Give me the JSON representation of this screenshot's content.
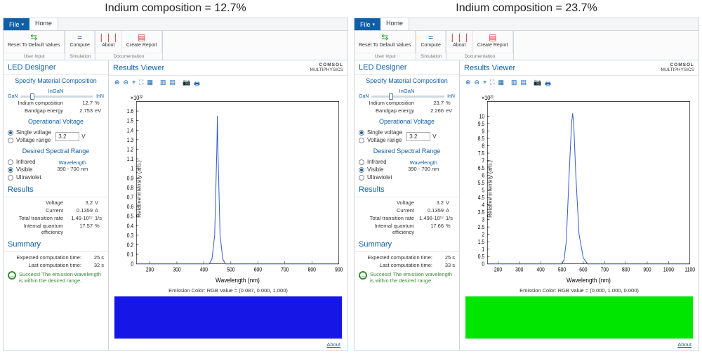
{
  "panels": [
    {
      "title_text": "Indium composition = 12.7%",
      "ribbon": {
        "file": "File",
        "home": "Home",
        "reset": "Reset To\nDefault Values",
        "compute": "Compute",
        "about": "About",
        "report": "Create\nReport",
        "grp_user": "User Input",
        "grp_sim": "Simulation",
        "grp_doc": "Documentation"
      },
      "left": {
        "header": "LED Designer",
        "spec_head": "Specify Material Composition",
        "ingan": "InGaN",
        "gan": "GaN",
        "inn": "InN",
        "slider_pos_pct": 12.7,
        "indium_k": "Indium composition",
        "indium_v": "12.7",
        "indium_u": "%",
        "bandgap_k": "Bandgap energy",
        "bandgap_v": "2.753",
        "bandgap_u": "eV",
        "op_head": "Operational Voltage",
        "single_v": "Single voltage",
        "range_v": "Voltage range",
        "voltage_val": "3.2",
        "voltage_u": "V",
        "spectral_head": "Desired Spectral Range",
        "r_ir": "Infrared",
        "r_vis": "Visible",
        "r_uv": "Ultraviolet",
        "wave_lbl": "Wavelength",
        "wave_range": "390 - 700 nm",
        "results_head": "Results",
        "res_voltage_k": "Voltage",
        "res_voltage_v": "3.2",
        "res_voltage_u": "V",
        "res_current_k": "Current",
        "res_current_v": "0.1359",
        "res_current_u": "A",
        "res_ttr_k": "Total transition rate",
        "res_ttr_v": "1.49·10¹⁷",
        "res_ttr_u": "1/s",
        "res_iqe_k": "Internal quantum efficiency",
        "res_iqe_v": "17.57",
        "res_iqe_u": "%",
        "summary_head": "Summary",
        "sum_ect_k": "Expected computation time:",
        "sum_ect_v": "25 s",
        "sum_lct_k": "Last computation time:",
        "sum_lct_v": "32 s",
        "success": "Success! The emission wavelength is within the desired range."
      },
      "right": {
        "header": "Results Viewer",
        "brand1": "COMSOL",
        "brand2": "MULTIPHYSICS",
        "y_mult": "×10²²",
        "ylabel": "Relative intensity (arb.)",
        "xlabel": "Wavelength (nm)",
        "emission": "Emission Color: RGB Value = (0.087, 0.000, 1.000)",
        "swatch_color": "#1616e7",
        "about": "About"
      },
      "chart_data": {
        "type": "line",
        "xlabel": "Wavelength (nm)",
        "ylabel": "Relative intensity (arb.) ×10^22",
        "xlim": [
          150,
          900
        ],
        "ylim": [
          0,
          1.7
        ],
        "x_ticks": [
          200,
          300,
          400,
          500,
          600,
          700,
          800,
          900
        ],
        "y_ticks": [
          0,
          0.1,
          0.2,
          0.3,
          0.4,
          0.5,
          0.6,
          0.7,
          0.8,
          0.9,
          1.0,
          1.1,
          1.2,
          1.3,
          1.4,
          1.5,
          1.6
        ],
        "series": [
          {
            "name": "intensity",
            "x": [
              420,
              430,
              440,
              448,
              450,
              452,
              460,
              470,
              480
            ],
            "values": [
              0,
              0.05,
              0.3,
              1.2,
              1.55,
              1.2,
              0.3,
              0.05,
              0
            ]
          }
        ]
      }
    },
    {
      "title_text": "Indium composition = 23.7%",
      "ribbon": {
        "file": "File",
        "home": "Home",
        "reset": "Reset To\nDefault Values",
        "compute": "Compute",
        "about": "About",
        "report": "Create\nReport",
        "grp_user": "User Input",
        "grp_sim": "Simulation",
        "grp_doc": "Documentation"
      },
      "left": {
        "header": "LED Designer",
        "spec_head": "Specify Material Composition",
        "ingan": "InGaN",
        "gan": "GaN",
        "inn": "InN",
        "slider_pos_pct": 23.7,
        "indium_k": "Indium composition",
        "indium_v": "23.7",
        "indium_u": "%",
        "bandgap_k": "Bandgap energy",
        "bandgap_v": "2.266",
        "bandgap_u": "eV",
        "op_head": "Operational Voltage",
        "single_v": "Single voltage",
        "range_v": "Voltage range",
        "voltage_val": "3.2",
        "voltage_u": "V",
        "spectral_head": "Desired Spectral Range",
        "r_ir": "Infrared",
        "r_vis": "Visible",
        "r_uv": "Ultraviolet",
        "wave_lbl": "Wavelength",
        "wave_range": "390 - 700 nm",
        "results_head": "Results",
        "res_voltage_k": "Voltage",
        "res_voltage_v": "3.2",
        "res_voltage_u": "V",
        "res_current_k": "Current",
        "res_current_v": "0.1359",
        "res_current_u": "A",
        "res_ttr_k": "Total transition rate",
        "res_ttr_v": "1.498·10¹⁷",
        "res_ttr_u": "1/s",
        "res_iqe_k": "Internal quantum efficiency",
        "res_iqe_v": "17.66",
        "res_iqe_u": "%",
        "summary_head": "Summary",
        "sum_ect_k": "Expected computation time:",
        "sum_ect_v": "25 s",
        "sum_lct_k": "Last computation time:",
        "sum_lct_v": "33 s",
        "success": "Success! The emission wavelength is within the desired range."
      },
      "right": {
        "header": "Results Viewer",
        "brand1": "COMSOL",
        "brand2": "MULTIPHYSICS",
        "y_mult": "×10²¹",
        "ylabel": "Relative intensity (arb.)",
        "xlabel": "Wavelength (nm)",
        "emission": "Emission Color: RGB Value = (0.000, 1.000, 0.000)",
        "swatch_color": "#00e600",
        "about": "About"
      },
      "chart_data": {
        "type": "line",
        "xlabel": "Wavelength (nm)",
        "ylabel": "Relative intensity (arb.) ×10^21",
        "xlim": [
          150,
          1100
        ],
        "ylim": [
          0,
          11
        ],
        "x_ticks": [
          200,
          300,
          400,
          500,
          600,
          700,
          800,
          900,
          1000,
          1100
        ],
        "y_ticks": [
          0,
          0.5,
          1,
          1.5,
          2,
          2.5,
          3,
          3.5,
          4,
          4.5,
          5,
          5.5,
          6,
          6.5,
          7,
          7.5,
          8,
          8.5,
          9,
          9.5,
          10
        ],
        "series": [
          {
            "name": "intensity",
            "x": [
              500,
              510,
              520,
              535,
              545,
              550,
              555,
              565,
              580,
              600,
              620
            ],
            "values": [
              0,
              0.3,
              1.5,
              6.5,
              9.5,
              10.2,
              9.5,
              6.0,
              2.0,
              0.4,
              0
            ]
          }
        ]
      }
    }
  ]
}
